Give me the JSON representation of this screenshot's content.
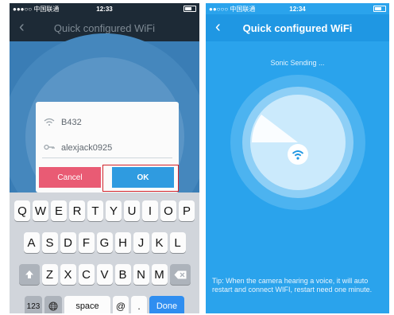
{
  "left_screen": {
    "status": {
      "carrier": "●●●○○ 中国联通",
      "time": "12:33"
    },
    "nav": {
      "back_icon": "‹",
      "title": "Quick configured WiFi"
    },
    "dialog": {
      "ssid": "B432",
      "password": "alexjack0925",
      "cancel_label": "Cancel",
      "ok_label": "OK"
    },
    "keyboard": {
      "row1": [
        "Q",
        "W",
        "E",
        "R",
        "T",
        "Y",
        "U",
        "I",
        "O",
        "P"
      ],
      "row2": [
        "A",
        "S",
        "D",
        "F",
        "G",
        "H",
        "J",
        "K",
        "L"
      ],
      "row3": [
        "Z",
        "X",
        "C",
        "V",
        "B",
        "N",
        "M"
      ],
      "numbers_label": "123",
      "space_label": "space",
      "at_label": "@",
      "dot_label": ".",
      "done_label": "Done"
    }
  },
  "right_screen": {
    "status": {
      "carrier": "●●○○○ 中国联通",
      "time": "12:34"
    },
    "nav": {
      "back_icon": "‹",
      "title": "Quick configured WiFi"
    },
    "status_text": "Sonic Sending ...",
    "tip": "Tip: When the camera hearing a voice, it will auto restart and connect WIFI, restart need one minute."
  },
  "colors": {
    "accent_blue": "#2aa3ec",
    "cancel_red": "#e95b74",
    "ok_blue": "#2f9be0",
    "highlight_red": "#d2232a"
  }
}
